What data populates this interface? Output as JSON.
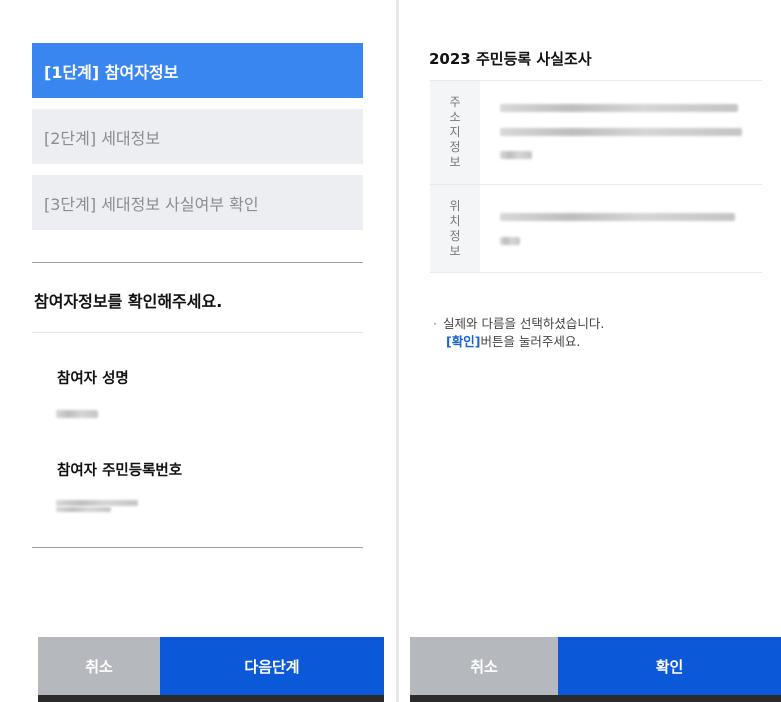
{
  "steps": [
    {
      "label": "[1단계] 참여자정보",
      "active": true
    },
    {
      "label": "[2단계] 세대정보",
      "active": false
    },
    {
      "label": "[3단계] 세대정보 사실여부 확인",
      "active": false
    }
  ],
  "left": {
    "section_title": "참여자정보를 확인해주세요.",
    "name_label": "참여자 성명",
    "id_label": "참여자 주민등록번호",
    "cancel_label": "취소",
    "next_label": "다음단계"
  },
  "right": {
    "title": "2023 주민등록 사실조사",
    "address_head": [
      "주",
      "소",
      "지",
      "정",
      "보"
    ],
    "location_head": [
      "위",
      "치",
      "정",
      "보"
    ],
    "notice_line1": "실제와 다름을 선택하셨습니다.",
    "notice_keyword": "[확인]",
    "notice_line2_rest": "버튼을 눌러주세요.",
    "cancel_label": "취소",
    "confirm_label": "확인"
  },
  "colors": {
    "active_step": "#3a86f0",
    "primary_button": "#0b59d9",
    "secondary_button": "#b5b9be",
    "keyword": "#1a62d8"
  }
}
